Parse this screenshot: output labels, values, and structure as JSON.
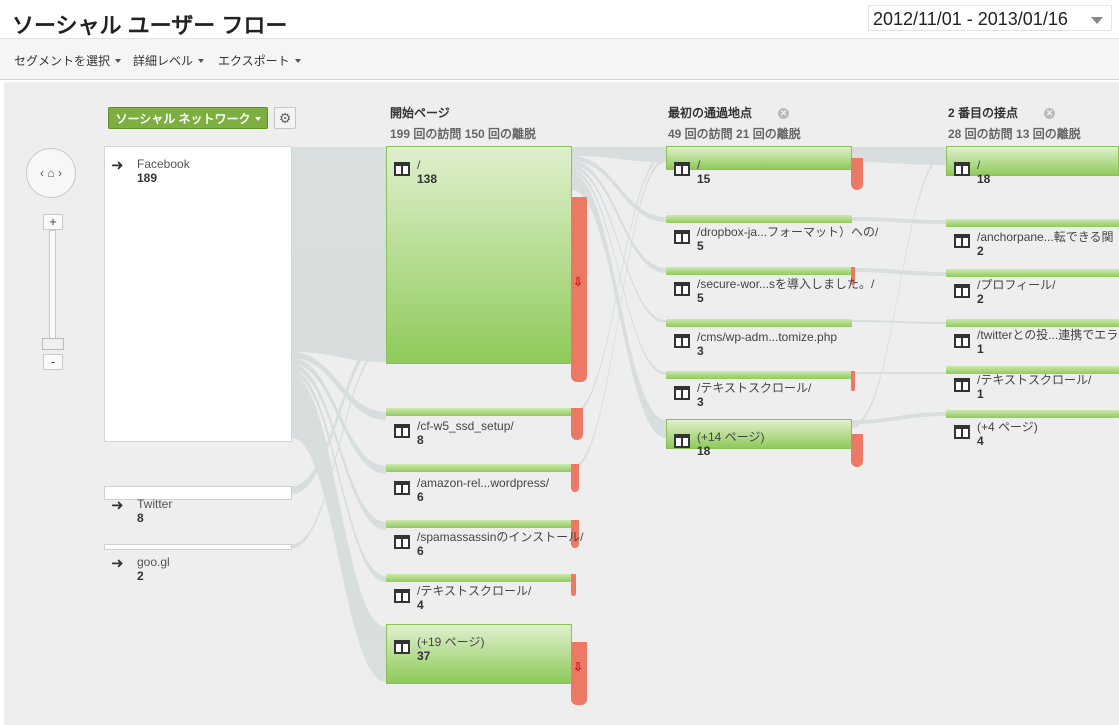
{
  "header": {
    "title": "ソーシャル ユーザー フロー",
    "date_range": "2012/11/01 - 2013/01/16"
  },
  "toolbar": {
    "segment": "セグメントを選択",
    "detail": "詳細レベル",
    "export": "エクスポート"
  },
  "controls": {
    "segment_button": "ソーシャル ネットワーク",
    "home_glyph": "‹ ⌂ ›",
    "zoom_in": "+",
    "zoom_out": "-"
  },
  "columns": [
    {
      "title": "開始ページ",
      "stats": "199 回の訪問 150 回の離脱"
    },
    {
      "title": "最初の通過地点",
      "stats": "49 回の訪問 21 回の離脱"
    },
    {
      "title": "2 番目の接点",
      "stats": "28 回の訪問 13 回の離脱"
    }
  ],
  "sources": [
    {
      "name": "Facebook",
      "count": "189"
    },
    {
      "name": "Twitter",
      "count": "8"
    },
    {
      "name": "goo.gl",
      "count": "2"
    }
  ],
  "start_pages": [
    {
      "label": "/",
      "count": "138"
    },
    {
      "label": "/cf-w5_ssd_setup/",
      "count": "8"
    },
    {
      "label": "/amazon-rel...wordpress/",
      "count": "6"
    },
    {
      "label": "/spamassassinのインストール/",
      "count": "6"
    },
    {
      "label": "/テキストスクロール/",
      "count": "4"
    },
    {
      "label": "(+19 ページ)",
      "count": "37"
    }
  ],
  "first_interaction": [
    {
      "label": "/",
      "count": "15"
    },
    {
      "label": "/dropbox-ja...フォーマット）への/",
      "count": "5"
    },
    {
      "label": "/secure-wor...sを導入しました。/",
      "count": "5"
    },
    {
      "label": "/cms/wp-adm...tomize.php",
      "count": "3"
    },
    {
      "label": "/テキストスクロール/",
      "count": "3"
    },
    {
      "label": "(+14 ページ)",
      "count": "18"
    }
  ],
  "second_interaction": [
    {
      "label": "/",
      "count": "18"
    },
    {
      "label": "/anchorpane...転できる関",
      "count": "2"
    },
    {
      "label": "/プロフィール/",
      "count": "2"
    },
    {
      "label": "/twitterとの投...連携でエラ",
      "count": "1"
    },
    {
      "label": "/テキストスクロール/",
      "count": "1"
    },
    {
      "label": "(+4 ページ)",
      "count": "4"
    }
  ],
  "drop_arrow_glyph": "⇩",
  "colors": {
    "node_green": "#8fca5a",
    "dropoff_red": "#ec7866",
    "flow_gray": "#d3dcdb",
    "segment_green": "#7daf40"
  }
}
